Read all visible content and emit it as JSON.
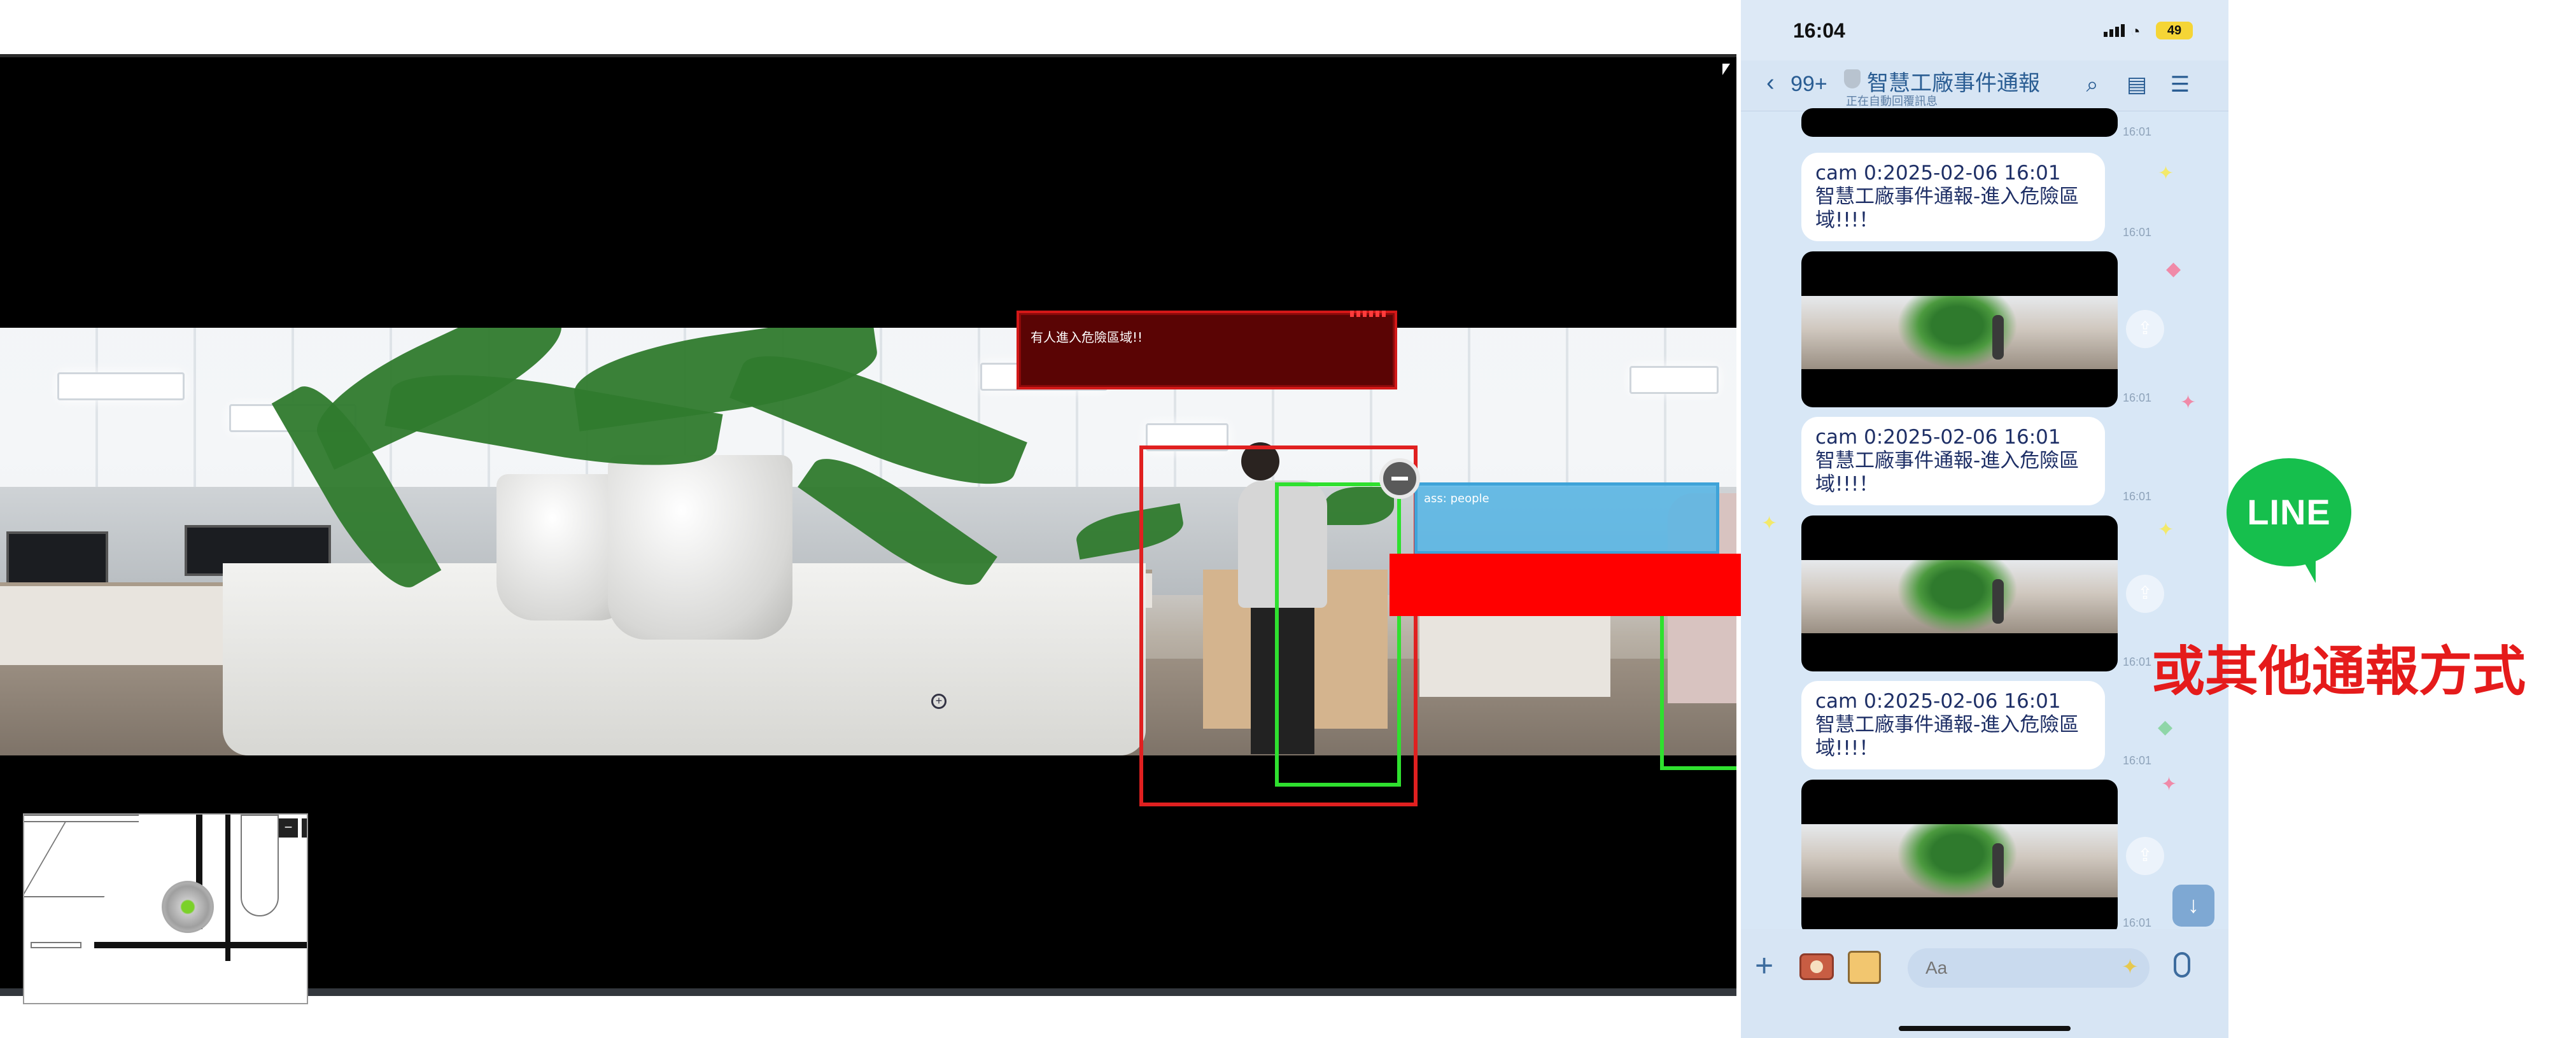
{
  "viewer": {
    "alert_text": "有人進入危險區域!!",
    "class_label": "ass: people",
    "minimap": {
      "minus": "−",
      "expand": "⤢"
    }
  },
  "phone": {
    "status": {
      "time": "16:04",
      "battery": "49"
    },
    "nav": {
      "back": "‹",
      "unread": "99+",
      "title": "智慧工廠事件通報",
      "subtitle": "正在自動回覆訊息",
      "icons": [
        "search-icon",
        "notes-icon",
        "menu-icon"
      ]
    },
    "messages": [
      {
        "type": "image",
        "time": "16:01"
      },
      {
        "type": "text",
        "line1": "cam 0:2025-02-06 16:01",
        "line2": "智慧工廠事件通報-進入危險區",
        "line3": "域!!!！",
        "time": "16:01"
      },
      {
        "type": "image",
        "time": "16:01"
      },
      {
        "type": "text",
        "line1": "cam 0:2025-02-06 16:01",
        "line2": "智慧工廠事件通報-進入危險區",
        "line3": "域!!!！",
        "time": "16:01"
      },
      {
        "type": "image",
        "time": "16:01"
      },
      {
        "type": "text",
        "line1": "cam 0:2025-02-06 16:01",
        "line2": "智慧工廠事件通報-進入危險區",
        "line3": "域!!!！",
        "time": "16:01"
      },
      {
        "type": "image",
        "time": "16:01"
      }
    ],
    "input": {
      "placeholder": "Aa"
    }
  },
  "line_logo": "LINE",
  "caption": "或其他通報方式",
  "colors": {
    "alert_red": "#e02020",
    "detect_green": "#2fe02f",
    "line_green": "#16bf4d",
    "caption_red": "#e51b1b"
  }
}
